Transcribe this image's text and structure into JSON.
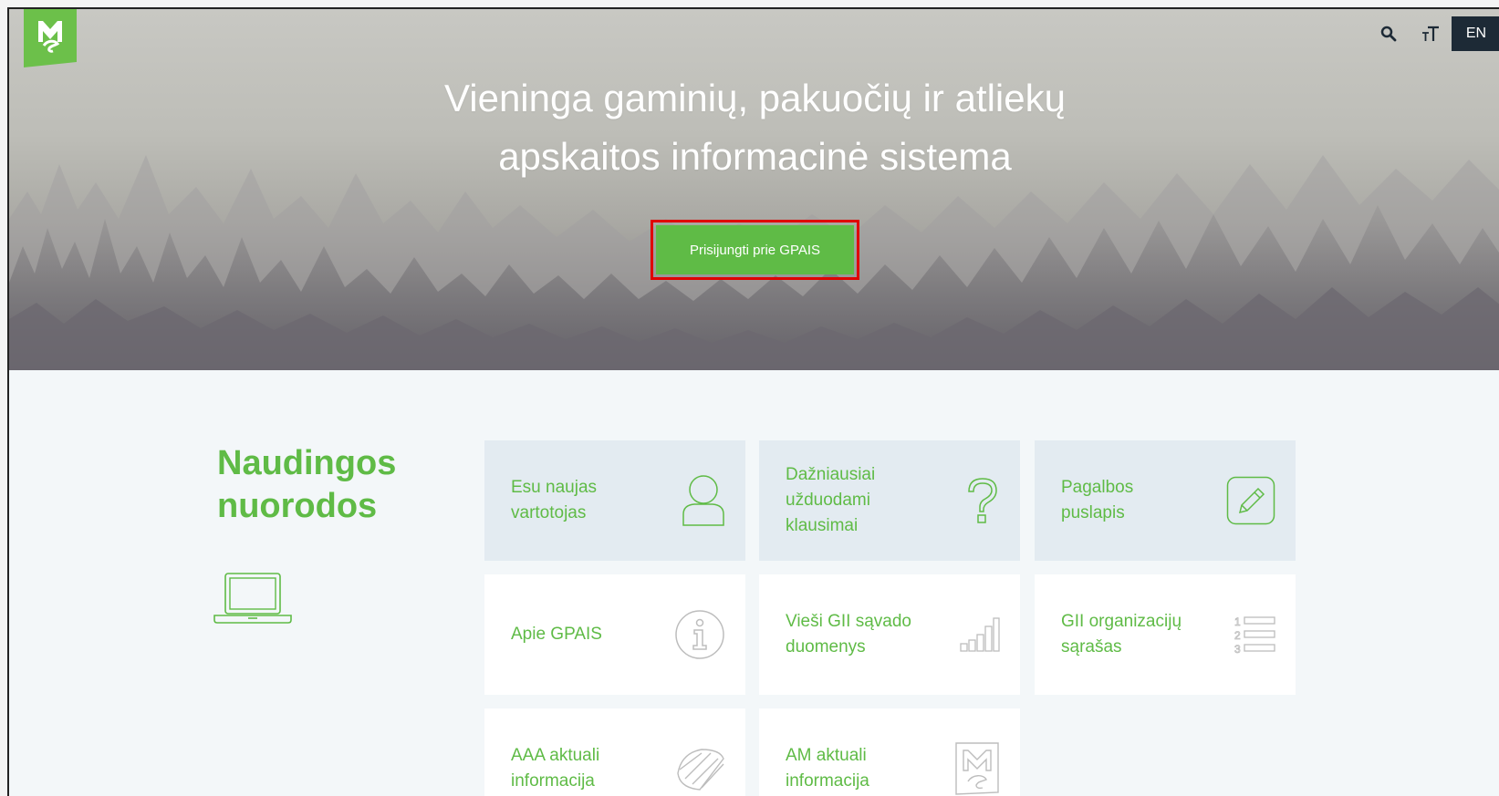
{
  "header": {
    "logo_icon": "ministry-logo-icon",
    "search_icon": "search-icon",
    "font_size_icon": "font-size-icon",
    "language_label": "EN"
  },
  "hero": {
    "title_line1": "Vieninga gaminių, pakuočių ir atliekų",
    "title_line2": "apskaitos informacinė sistema",
    "cta_label": "Prisijungti prie GPAIS"
  },
  "links": {
    "title_line1": "Naudingos",
    "title_line2": "nuorodos",
    "illustration_icon": "laptop-icon",
    "tiles": [
      {
        "lines": [
          "Esu naujas",
          "vartotojas"
        ],
        "icon": "user-icon"
      },
      {
        "lines": [
          "Dažniausiai",
          "užduodami",
          "klausimai"
        ],
        "icon": "question-icon"
      },
      {
        "lines": [
          "Pagalbos",
          "puslapis"
        ],
        "icon": "pencil-icon"
      },
      {
        "lines": [
          "Apie GPAIS"
        ],
        "icon": "info-icon"
      },
      {
        "lines": [
          "Vieši GII sąvado",
          "duomenys"
        ],
        "icon": "bar-chart-icon"
      },
      {
        "lines": [
          "GII organizacijų",
          "sąrašas"
        ],
        "icon": "numbered-list-icon"
      },
      {
        "lines": [
          "AAA aktuali",
          "informacija"
        ],
        "icon": "aaa-logo-icon"
      },
      {
        "lines": [
          "AM aktuali",
          "informacija"
        ],
        "icon": "am-logo-icon"
      }
    ]
  },
  "colors": {
    "brand_green": "#5fbb46",
    "dark_navy": "#1d2a36",
    "tile_shaded": "#e3ebf1",
    "highlight_red": "#e00000"
  }
}
